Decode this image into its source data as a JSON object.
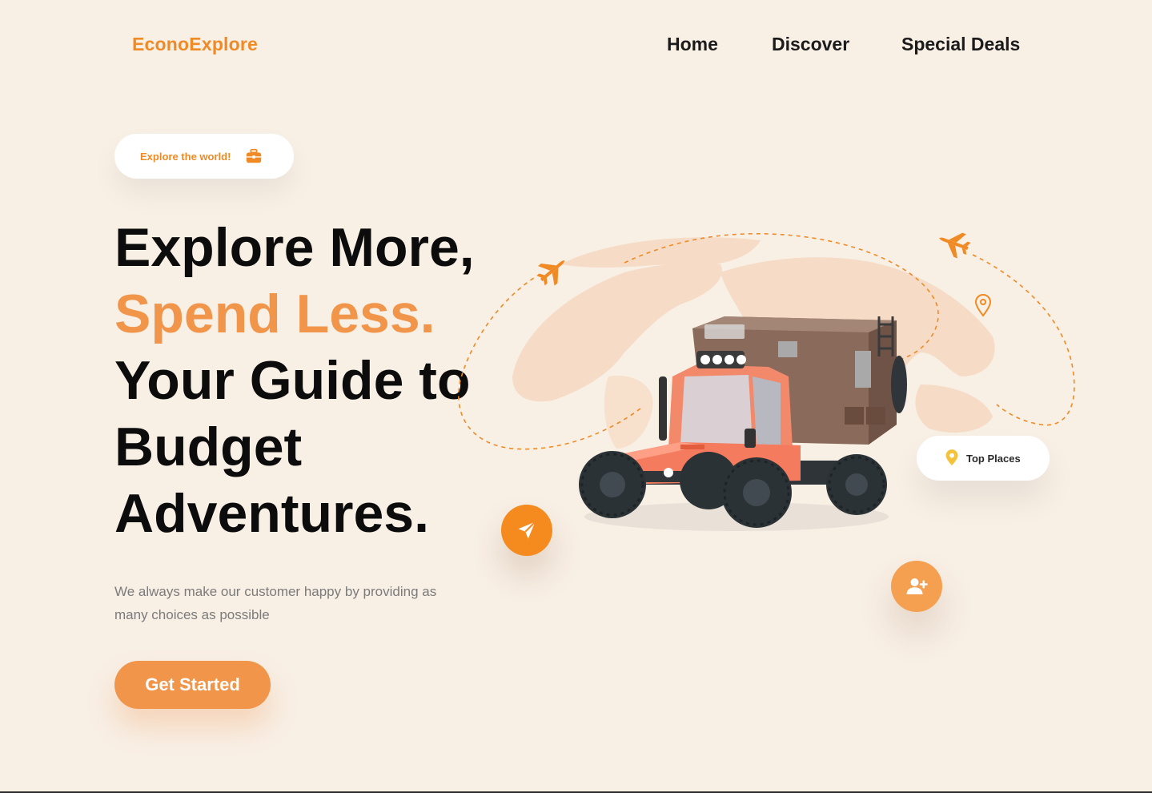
{
  "header": {
    "logo": "EconoExplore",
    "nav": [
      "Home",
      "Discover",
      "Special Deals"
    ]
  },
  "hero": {
    "badge_label": "Explore the world!",
    "headline_line1": "Explore More,",
    "headline_line2": "Spend Less.",
    "headline_line3": "Your Guide to",
    "headline_line4": "Budget",
    "headline_line5": "Adventures.",
    "description": "We always make our customer happy by providing as many choices as possible",
    "cta_label": "Get Started"
  },
  "illustration": {
    "top_places_label": "Top Places"
  },
  "colors": {
    "accent": "#f08a24",
    "accent_soft": "#f0954a",
    "background": "#f8efe5",
    "text": "#0c0c0c"
  },
  "icons": [
    "briefcase-icon",
    "airplane-icon",
    "map-pin-icon",
    "send-icon",
    "user-plus-icon",
    "world-map",
    "camper-truck"
  ]
}
